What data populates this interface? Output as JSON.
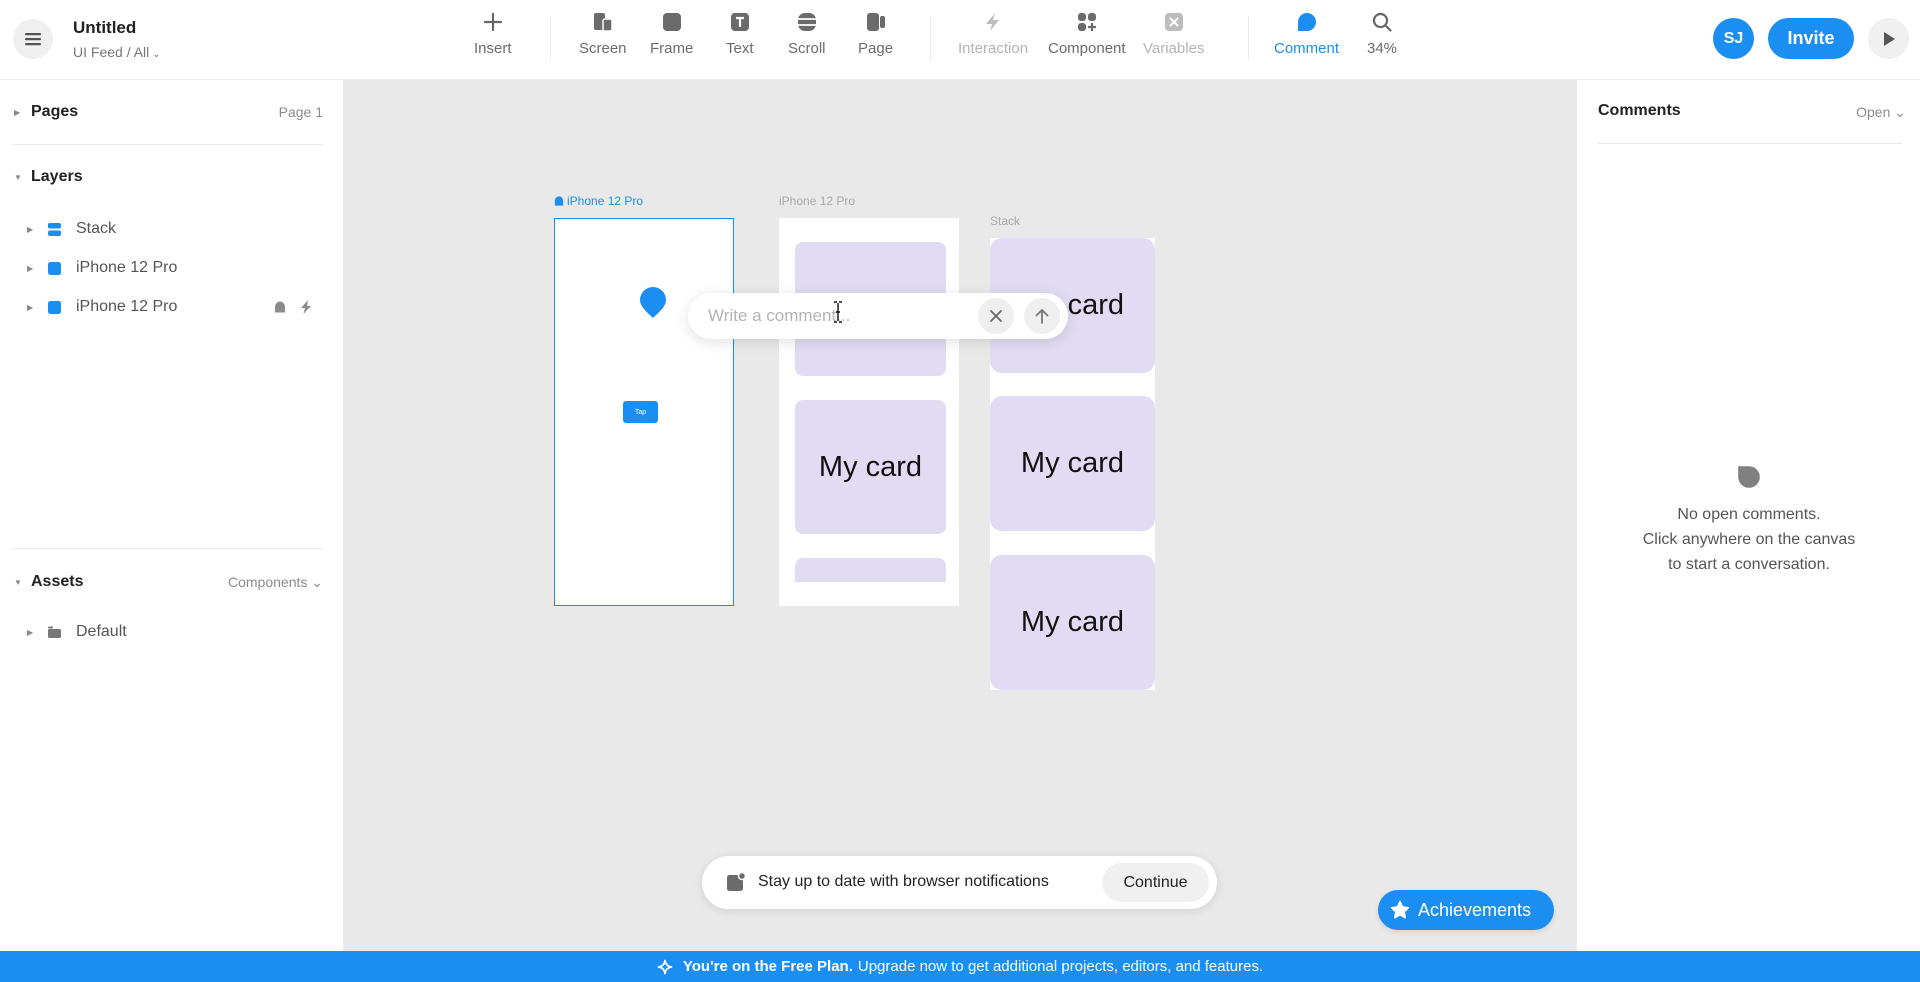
{
  "header": {
    "title": "Untitled",
    "path": "UI Feed / All",
    "tools": [
      {
        "label": "Insert",
        "icon": "plus-icon",
        "state": "normal"
      },
      {
        "label": "Screen",
        "icon": "screen-icon",
        "state": "normal"
      },
      {
        "label": "Frame",
        "icon": "frame-icon",
        "state": "normal"
      },
      {
        "label": "Text",
        "icon": "text-icon",
        "state": "normal"
      },
      {
        "label": "Scroll",
        "icon": "scroll-icon",
        "state": "normal"
      },
      {
        "label": "Page",
        "icon": "page-icon",
        "state": "normal"
      },
      {
        "label": "Interaction",
        "icon": "lightning-icon",
        "state": "disabled"
      },
      {
        "label": "Component",
        "icon": "component-icon",
        "state": "normal"
      },
      {
        "label": "Variables",
        "icon": "variables-icon",
        "state": "disabled"
      },
      {
        "label": "Comment",
        "icon": "comment-icon",
        "state": "active"
      },
      {
        "label": "34%",
        "icon": "zoom-icon",
        "state": "normal"
      }
    ],
    "avatar_initials": "SJ",
    "invite_label": "Invite"
  },
  "left_panel": {
    "pages": {
      "title": "Pages",
      "current": "Page 1"
    },
    "layers": {
      "title": "Layers",
      "items": [
        {
          "name": "Stack",
          "icon": "stack-icon"
        },
        {
          "name": "iPhone 12 Pro",
          "icon": "frame-icon"
        },
        {
          "name": "iPhone 12 Pro",
          "icon": "frame-icon",
          "badges": [
            "home-icon",
            "lightning-icon"
          ]
        }
      ]
    },
    "assets": {
      "title": "Assets",
      "filter": "Components",
      "items": [
        {
          "name": "Default",
          "icon": "folder-icon"
        }
      ]
    }
  },
  "canvas": {
    "frames": [
      {
        "label": "iPhone 12 Pro",
        "selected": true,
        "home": true,
        "button_label": "Tap"
      },
      {
        "label": "iPhone 12 Pro",
        "selected": false
      },
      {
        "label": "Stack",
        "selected": false
      }
    ],
    "card_label": "My card",
    "comment_placeholder": "Write a comment..."
  },
  "right_panel": {
    "title": "Comments",
    "filter": "Open",
    "empty_line1": "No open comments.",
    "empty_line2": "Click anywhere on the canvas",
    "empty_line3": "to start a conversation."
  },
  "notification": {
    "text": "Stay up to date with browser notifications",
    "button": "Continue"
  },
  "achievements_label": "Achievements",
  "banner": {
    "bold": "You're on the Free Plan.",
    "text": "Upgrade now to get additional projects, editors, and features."
  },
  "colors": {
    "accent": "#1b8ef2",
    "card": "#e1dcf3",
    "canvas": "#e9e9e9"
  }
}
